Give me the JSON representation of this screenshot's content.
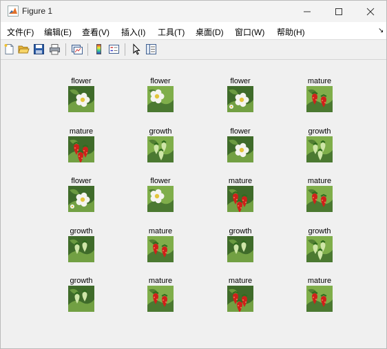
{
  "window": {
    "title": "Figure 1"
  },
  "menu": [
    "文件(F)",
    "编辑(E)",
    "查看(V)",
    "插入(I)",
    "工具(T)",
    "桌面(D)",
    "窗口(W)",
    "帮助(H)"
  ],
  "toolbar": [
    {
      "icon": "new-figure-icon"
    },
    {
      "icon": "open-file-icon"
    },
    {
      "icon": "save-icon"
    },
    {
      "icon": "print-icon"
    },
    {
      "icon": "link-plot-icon"
    },
    {
      "icon": "insert-colorbar-icon"
    },
    {
      "icon": "insert-legend-icon"
    },
    {
      "icon": "edit-plot-pointer-icon"
    },
    {
      "icon": "property-inspector-icon"
    }
  ],
  "grid": [
    [
      {
        "label": "flower",
        "kind": "flower"
      },
      {
        "label": "flower",
        "kind": "flower"
      },
      {
        "label": "flower",
        "kind": "flower"
      },
      {
        "label": "mature",
        "kind": "mature"
      }
    ],
    [
      {
        "label": "mature",
        "kind": "mature"
      },
      {
        "label": "growth",
        "kind": "growth"
      },
      {
        "label": "flower",
        "kind": "flower"
      },
      {
        "label": "growth",
        "kind": "growth"
      }
    ],
    [
      {
        "label": "flower",
        "kind": "flower"
      },
      {
        "label": "flower",
        "kind": "flower"
      },
      {
        "label": "mature",
        "kind": "mature"
      },
      {
        "label": "mature",
        "kind": "mature"
      }
    ],
    [
      {
        "label": "growth",
        "kind": "growth"
      },
      {
        "label": "mature",
        "kind": "mature"
      },
      {
        "label": "growth",
        "kind": "growth"
      },
      {
        "label": "growth",
        "kind": "growth"
      }
    ],
    [
      {
        "label": "growth",
        "kind": "growth"
      },
      {
        "label": "mature",
        "kind": "mature"
      },
      {
        "label": "mature",
        "kind": "mature"
      },
      {
        "label": "mature",
        "kind": "mature"
      }
    ]
  ],
  "colors": {
    "leaf_dark": "#3f6b2a",
    "leaf_light": "#7fae4a",
    "petal": "#f4f4ee",
    "pistil": "#e3c53a",
    "berry_red": "#d0201a",
    "berry_green": "#cfe6a8"
  }
}
